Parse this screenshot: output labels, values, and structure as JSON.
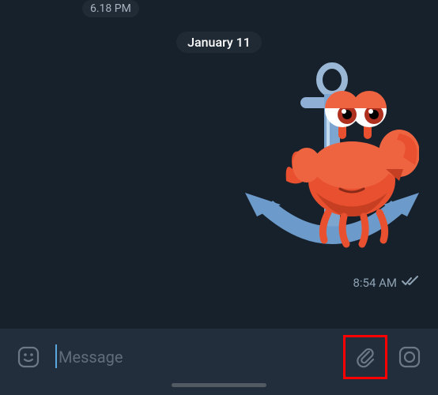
{
  "messages": {
    "prev_time": "6.18 PM",
    "date_divider": "January 11",
    "sticker": {
      "name": "crab-anchor-sticker",
      "time": "8:54 AM",
      "status": "read"
    }
  },
  "input": {
    "placeholder": "Message",
    "value": ""
  },
  "icons": {
    "emoji": "emoji-icon",
    "attach": "attach-icon",
    "camera": "camera-icon"
  }
}
